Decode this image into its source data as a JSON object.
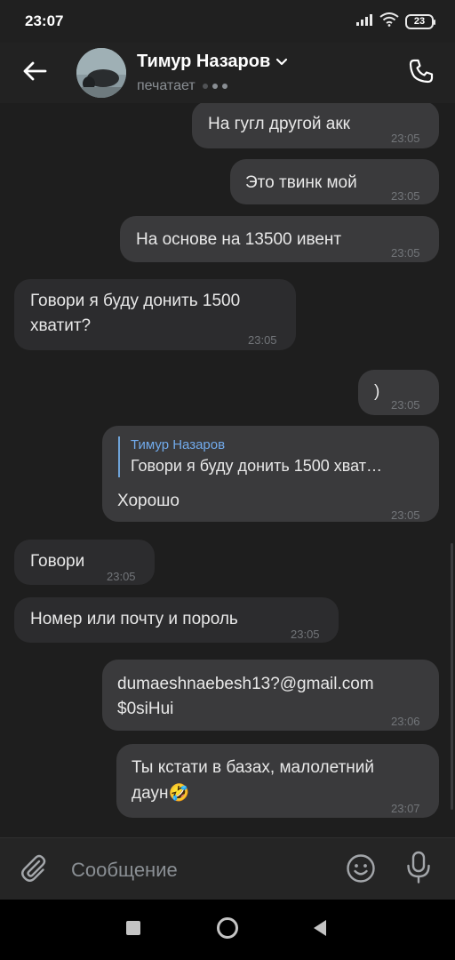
{
  "status_bar": {
    "time": "23:07",
    "battery": "23",
    "icons": [
      "signal-icon",
      "wifi-icon",
      "battery-icon"
    ]
  },
  "header": {
    "contact_name": "Тимур Назаров",
    "status": "печатает",
    "icons": [
      "back-arrow-icon",
      "chevron-down-icon",
      "phone-icon"
    ]
  },
  "messages": [
    {
      "direction": "out",
      "text": "На гугл другой акк",
      "time": "23:05"
    },
    {
      "direction": "out",
      "text": "Это твинк мой",
      "time": "23:05"
    },
    {
      "direction": "out",
      "text": "На основе на 13500 ивент",
      "time": "23:05"
    },
    {
      "direction": "in",
      "lines": [
        "Говори я буду донить 1500",
        "хватит?"
      ],
      "time": "23:05"
    },
    {
      "direction": "out",
      "text": ")",
      "time": "23:05"
    },
    {
      "direction": "out",
      "reply_to": {
        "author": "Тимур Назаров",
        "text": "Говори я буду донить 1500 хват…"
      },
      "text": "Хорошо",
      "time": "23:05"
    },
    {
      "direction": "in",
      "text": "Говори",
      "time": "23:05"
    },
    {
      "direction": "in",
      "text": "Номер или почту и пороль",
      "time": "23:05"
    },
    {
      "direction": "out",
      "lines": [
        "dumaeshnaebesh13?@gmail.com",
        "$0siHui"
      ],
      "time": "23:06"
    },
    {
      "direction": "out",
      "lines": [
        "Ты кстати в базах, малолетний",
        "даун"
      ],
      "emoji": "🤣",
      "time": "23:07"
    }
  ],
  "input": {
    "placeholder": "Сообщение",
    "icons": [
      "paperclip-icon",
      "emoji-icon",
      "microphone-icon"
    ]
  },
  "colors": {
    "background": "#1e1e1e",
    "bubble_out": "#3a3a3c",
    "bubble_in": "#2c2c2e",
    "accent": "#71aaeb",
    "time_text": "#727579"
  }
}
